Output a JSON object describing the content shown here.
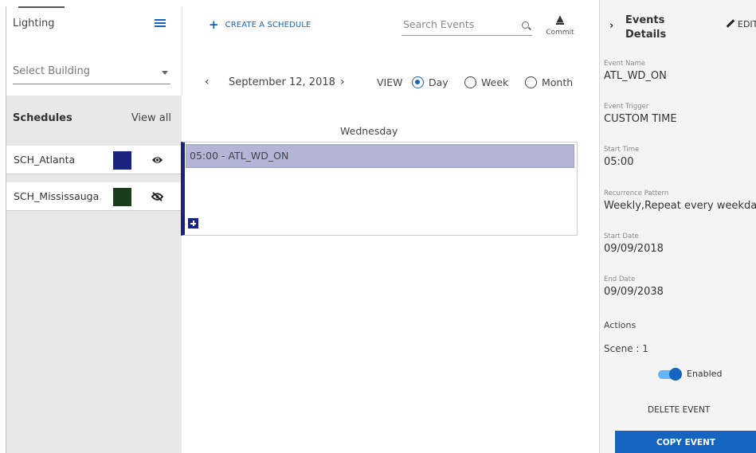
{
  "sidebar": {
    "title": "Lighting",
    "list_icon": "list-icon",
    "building_select": {
      "placeholder": "Select Building"
    },
    "schedules_title": "Schedules",
    "view_all": "View all",
    "schedules": [
      {
        "name": "SCH_Atlanta",
        "color": "#1a237e",
        "visibility": "visible",
        "icon": "eye-icon"
      },
      {
        "name": "SCH_Mississauga",
        "color": "#1b3d1b",
        "visibility": "hidden",
        "icon": "eye-off-icon"
      }
    ]
  },
  "toolbar": {
    "create_label": "CREATE A SCHEDULE",
    "search_placeholder": "Search Events",
    "commit_label": "Commit"
  },
  "calendar": {
    "date": "September 12, 2018",
    "view_label": "VIEW",
    "views": [
      {
        "label": "Day",
        "selected": true
      },
      {
        "label": "Week",
        "selected": false
      },
      {
        "label": "Month",
        "selected": false
      }
    ],
    "day_name": "Wednesday",
    "events": [
      {
        "label": "05:00 - ATL_WD_ON",
        "color": "#b2b5d6"
      }
    ]
  },
  "details": {
    "title": "Events Details",
    "edit_label": "EDIT",
    "fields": [
      {
        "key": "Event Name",
        "value": "ATL_WD_ON"
      },
      {
        "key": "Event Trigger",
        "value": "CUSTOM TIME"
      },
      {
        "key": "Start Time",
        "value": "05:00"
      },
      {
        "key": "Recurrence Pattern",
        "value": "Weekly,Repeat every weekda"
      },
      {
        "key": "Start Date",
        "value": "09/09/2018"
      },
      {
        "key": "End Date",
        "value": "09/09/2038"
      }
    ],
    "actions_label": "Actions",
    "scene_label": "Scene : 1",
    "toggle": {
      "label": "Enabled",
      "on": true
    },
    "delete_label": "DELETE EVENT",
    "copy_label": "COPY EVENT",
    "accent_color": "#1565c0"
  }
}
